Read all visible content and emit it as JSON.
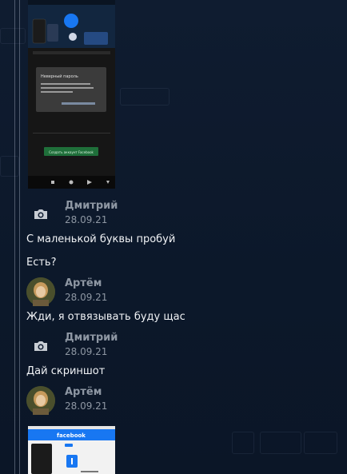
{
  "messages": [
    {
      "author": "Дмитрий",
      "date": "28.09.21",
      "avatar": "camera-icon",
      "texts": [
        "С маленькой буквы пробуй",
        "Есть?"
      ]
    },
    {
      "author": "Артём",
      "date": "28.09.21",
      "avatar": "user-photo",
      "texts": [
        "Жди, я отвязывать буду щас"
      ]
    },
    {
      "author": "Дмитрий",
      "date": "28.09.21",
      "avatar": "camera-icon",
      "texts": [
        "Дай скриншот"
      ]
    },
    {
      "author": "Артём",
      "date": "28.09.21",
      "avatar": "user-photo",
      "texts": []
    }
  ],
  "attachments": {
    "top_screenshot": {
      "dialog_title": "Неверный пароль",
      "button_label": "Создать аккаунт Facebook"
    },
    "bottom_screenshot": {
      "header_label": "facebook"
    }
  },
  "colors": {
    "background": "#0d1a2e",
    "meta_text": "#8e97a3",
    "message_text": "#f1f3f6",
    "facebook_blue": "#1877f2"
  }
}
